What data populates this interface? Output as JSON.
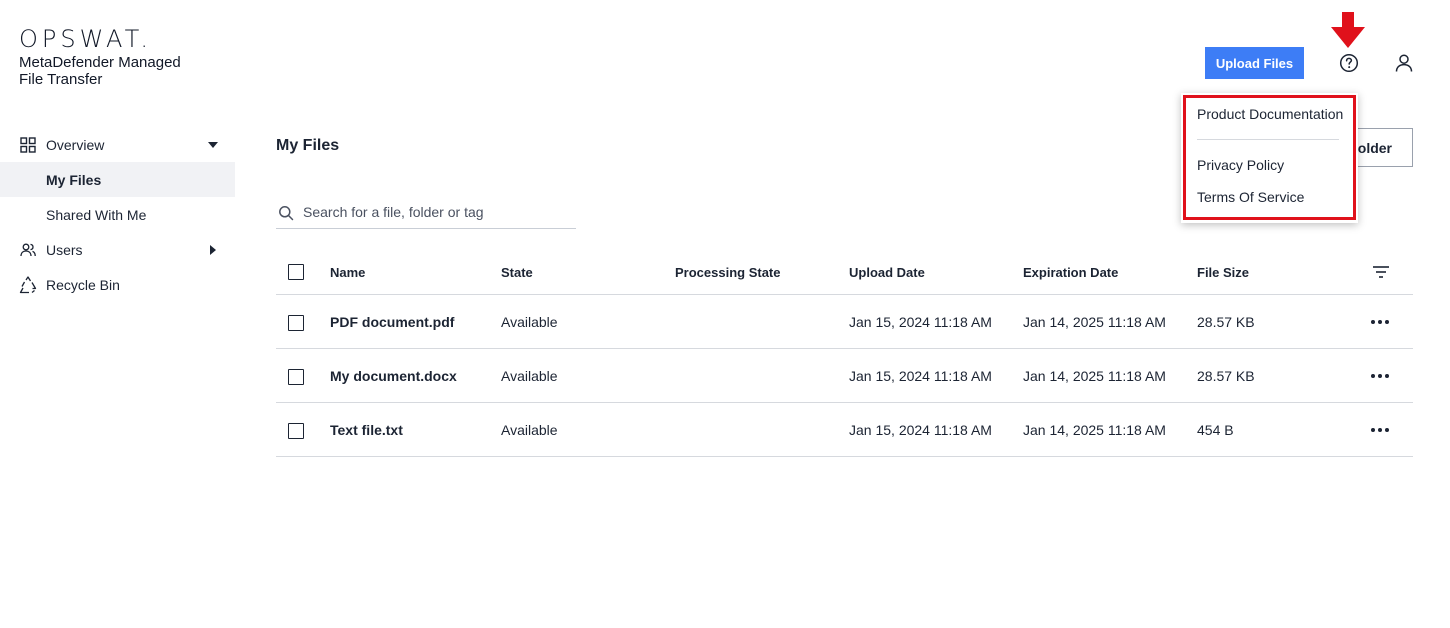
{
  "brand": {
    "logo": "OPSWAT.",
    "product_line1": "MetaDefender Managed",
    "product_line2": "File Transfer"
  },
  "header": {
    "upload_label": "Upload Files",
    "help_icon": "help-circle-icon",
    "user_icon": "user-icon"
  },
  "sidebar": {
    "items": [
      {
        "label": "Overview",
        "icon": "grid-icon",
        "expanded": true
      },
      {
        "label": "My Files",
        "active": true
      },
      {
        "label": "Shared With Me"
      },
      {
        "label": "Users",
        "icon": "users-icon"
      },
      {
        "label": "Recycle Bin",
        "icon": "recycle-icon"
      }
    ]
  },
  "main": {
    "title": "My Files",
    "folder_button": "Folder",
    "search_placeholder": "Search for a file, folder or tag"
  },
  "table": {
    "columns": [
      "Name",
      "State",
      "Processing State",
      "Upload Date",
      "Expiration Date",
      "File Size"
    ],
    "rows": [
      {
        "name": "PDF document.pdf",
        "state": "Available",
        "processing": "",
        "upload": "Jan 15, 2024 11:18 AM",
        "expiration": "Jan 14, 2025 11:18 AM",
        "size": "28.57 KB"
      },
      {
        "name": "My document.docx",
        "state": "Available",
        "processing": "",
        "upload": "Jan 15, 2024 11:18 AM",
        "expiration": "Jan 14, 2025 11:18 AM",
        "size": "28.57 KB"
      },
      {
        "name": "Text file.txt",
        "state": "Available",
        "processing": "",
        "upload": "Jan 15, 2024 11:18 AM",
        "expiration": "Jan 14, 2025 11:18 AM",
        "size": "454 B"
      }
    ]
  },
  "help_menu": {
    "items": [
      "Product Documentation",
      "Privacy Policy",
      "Terms Of Service"
    ]
  },
  "colors": {
    "accent": "#3d7df6",
    "highlight": "#e0111b"
  }
}
